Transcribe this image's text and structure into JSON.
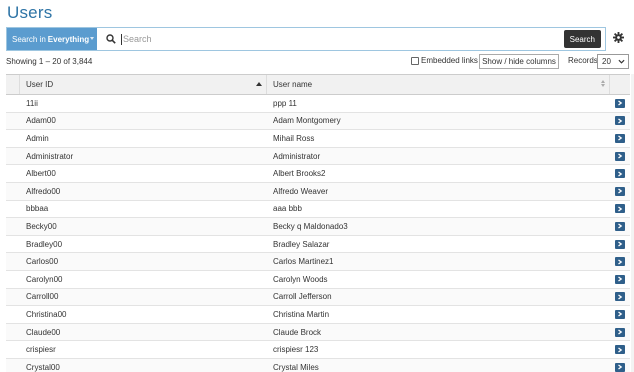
{
  "page": {
    "title": "Users"
  },
  "search": {
    "scope_prefix": "Search in",
    "scope_value": "Everything",
    "placeholder": "Search",
    "button_label": "Search"
  },
  "toolbar": {
    "showing_text": "Showing 1 – 20 of 3,844",
    "embedded_links_label": "Embedded links",
    "embedded_links_checked": false,
    "show_hide_label": "Show / hide columns",
    "records_label": "Records",
    "records_value": "20"
  },
  "table": {
    "columns": [
      "User ID",
      "User name"
    ],
    "sorted_column": "User ID",
    "rows": [
      {
        "user_id": "11ii",
        "user_name": "ppp 11"
      },
      {
        "user_id": "Adam00",
        "user_name": "Adam Montgomery"
      },
      {
        "user_id": "Admin",
        "user_name": "Mihail Ross"
      },
      {
        "user_id": "Administrator",
        "user_name": "Administrator"
      },
      {
        "user_id": "Albert00",
        "user_name": "Albert Brooks2"
      },
      {
        "user_id": "Alfredo00",
        "user_name": "Alfredo Weaver"
      },
      {
        "user_id": "bbbaa",
        "user_name": "aaa bbb"
      },
      {
        "user_id": "Becky00",
        "user_name": "Becky q Maldonado3"
      },
      {
        "user_id": "Bradley00",
        "user_name": "Bradley Salazar"
      },
      {
        "user_id": "Carlos00",
        "user_name": "Carlos Martinez1"
      },
      {
        "user_id": "Carolyn00",
        "user_name": "Carolyn Woods"
      },
      {
        "user_id": "Carroll00",
        "user_name": "Carroll Jefferson"
      },
      {
        "user_id": "Christina00",
        "user_name": "Christina Martin"
      },
      {
        "user_id": "Claude00",
        "user_name": "Claude Brock"
      },
      {
        "user_id": "crispiesr",
        "user_name": "crispiesr 123"
      },
      {
        "user_id": "Crystal00",
        "user_name": "Crystal Miles"
      }
    ]
  },
  "icons": {
    "search": "search-icon",
    "settings": "gear-icon",
    "row_action": "chevron-right-icon",
    "dropdown": "chevron-down-icon"
  },
  "colors": {
    "title": "#2e74a6",
    "scope_button": "#5b9ccf",
    "search_button": "#333333",
    "row_action_button": "#2f5f8a"
  }
}
